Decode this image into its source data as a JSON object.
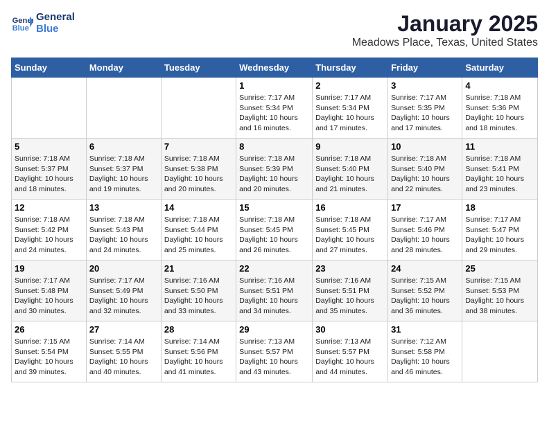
{
  "logo": {
    "line1": "General",
    "line2": "Blue"
  },
  "title": "January 2025",
  "subtitle": "Meadows Place, Texas, United States",
  "headers": [
    "Sunday",
    "Monday",
    "Tuesday",
    "Wednesday",
    "Thursday",
    "Friday",
    "Saturday"
  ],
  "weeks": [
    [
      {
        "day": "",
        "info": ""
      },
      {
        "day": "",
        "info": ""
      },
      {
        "day": "",
        "info": ""
      },
      {
        "day": "1",
        "info": "Sunrise: 7:17 AM\nSunset: 5:34 PM\nDaylight: 10 hours\nand 16 minutes."
      },
      {
        "day": "2",
        "info": "Sunrise: 7:17 AM\nSunset: 5:34 PM\nDaylight: 10 hours\nand 17 minutes."
      },
      {
        "day": "3",
        "info": "Sunrise: 7:17 AM\nSunset: 5:35 PM\nDaylight: 10 hours\nand 17 minutes."
      },
      {
        "day": "4",
        "info": "Sunrise: 7:18 AM\nSunset: 5:36 PM\nDaylight: 10 hours\nand 18 minutes."
      }
    ],
    [
      {
        "day": "5",
        "info": "Sunrise: 7:18 AM\nSunset: 5:37 PM\nDaylight: 10 hours\nand 18 minutes."
      },
      {
        "day": "6",
        "info": "Sunrise: 7:18 AM\nSunset: 5:37 PM\nDaylight: 10 hours\nand 19 minutes."
      },
      {
        "day": "7",
        "info": "Sunrise: 7:18 AM\nSunset: 5:38 PM\nDaylight: 10 hours\nand 20 minutes."
      },
      {
        "day": "8",
        "info": "Sunrise: 7:18 AM\nSunset: 5:39 PM\nDaylight: 10 hours\nand 20 minutes."
      },
      {
        "day": "9",
        "info": "Sunrise: 7:18 AM\nSunset: 5:40 PM\nDaylight: 10 hours\nand 21 minutes."
      },
      {
        "day": "10",
        "info": "Sunrise: 7:18 AM\nSunset: 5:40 PM\nDaylight: 10 hours\nand 22 minutes."
      },
      {
        "day": "11",
        "info": "Sunrise: 7:18 AM\nSunset: 5:41 PM\nDaylight: 10 hours\nand 23 minutes."
      }
    ],
    [
      {
        "day": "12",
        "info": "Sunrise: 7:18 AM\nSunset: 5:42 PM\nDaylight: 10 hours\nand 24 minutes."
      },
      {
        "day": "13",
        "info": "Sunrise: 7:18 AM\nSunset: 5:43 PM\nDaylight: 10 hours\nand 24 minutes."
      },
      {
        "day": "14",
        "info": "Sunrise: 7:18 AM\nSunset: 5:44 PM\nDaylight: 10 hours\nand 25 minutes."
      },
      {
        "day": "15",
        "info": "Sunrise: 7:18 AM\nSunset: 5:45 PM\nDaylight: 10 hours\nand 26 minutes."
      },
      {
        "day": "16",
        "info": "Sunrise: 7:18 AM\nSunset: 5:45 PM\nDaylight: 10 hours\nand 27 minutes."
      },
      {
        "day": "17",
        "info": "Sunrise: 7:17 AM\nSunset: 5:46 PM\nDaylight: 10 hours\nand 28 minutes."
      },
      {
        "day": "18",
        "info": "Sunrise: 7:17 AM\nSunset: 5:47 PM\nDaylight: 10 hours\nand 29 minutes."
      }
    ],
    [
      {
        "day": "19",
        "info": "Sunrise: 7:17 AM\nSunset: 5:48 PM\nDaylight: 10 hours\nand 30 minutes."
      },
      {
        "day": "20",
        "info": "Sunrise: 7:17 AM\nSunset: 5:49 PM\nDaylight: 10 hours\nand 32 minutes."
      },
      {
        "day": "21",
        "info": "Sunrise: 7:16 AM\nSunset: 5:50 PM\nDaylight: 10 hours\nand 33 minutes."
      },
      {
        "day": "22",
        "info": "Sunrise: 7:16 AM\nSunset: 5:51 PM\nDaylight: 10 hours\nand 34 minutes."
      },
      {
        "day": "23",
        "info": "Sunrise: 7:16 AM\nSunset: 5:51 PM\nDaylight: 10 hours\nand 35 minutes."
      },
      {
        "day": "24",
        "info": "Sunrise: 7:15 AM\nSunset: 5:52 PM\nDaylight: 10 hours\nand 36 minutes."
      },
      {
        "day": "25",
        "info": "Sunrise: 7:15 AM\nSunset: 5:53 PM\nDaylight: 10 hours\nand 38 minutes."
      }
    ],
    [
      {
        "day": "26",
        "info": "Sunrise: 7:15 AM\nSunset: 5:54 PM\nDaylight: 10 hours\nand 39 minutes."
      },
      {
        "day": "27",
        "info": "Sunrise: 7:14 AM\nSunset: 5:55 PM\nDaylight: 10 hours\nand 40 minutes."
      },
      {
        "day": "28",
        "info": "Sunrise: 7:14 AM\nSunset: 5:56 PM\nDaylight: 10 hours\nand 41 minutes."
      },
      {
        "day": "29",
        "info": "Sunrise: 7:13 AM\nSunset: 5:57 PM\nDaylight: 10 hours\nand 43 minutes."
      },
      {
        "day": "30",
        "info": "Sunrise: 7:13 AM\nSunset: 5:57 PM\nDaylight: 10 hours\nand 44 minutes."
      },
      {
        "day": "31",
        "info": "Sunrise: 7:12 AM\nSunset: 5:58 PM\nDaylight: 10 hours\nand 46 minutes."
      },
      {
        "day": "",
        "info": ""
      }
    ]
  ]
}
